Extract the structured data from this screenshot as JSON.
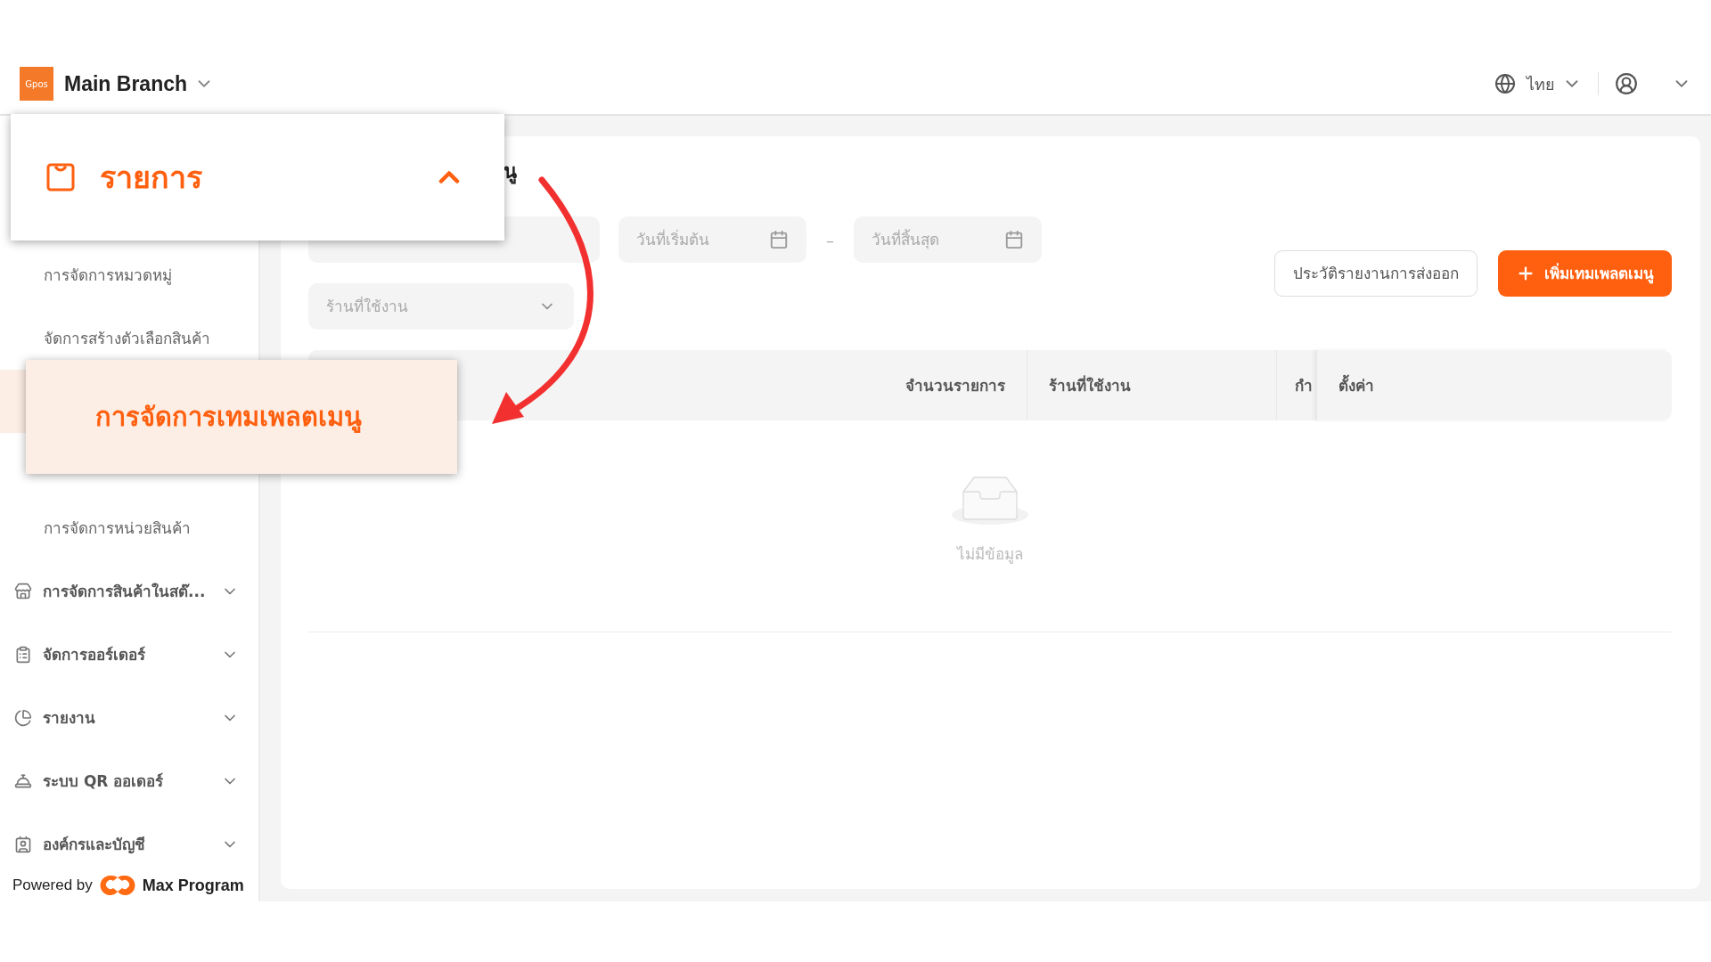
{
  "header": {
    "logo": "Gpos",
    "branch": "Main Branch",
    "language": "ไทย"
  },
  "sidebar": {
    "sub_items": [
      {
        "label": "การจัดการหมวดหมู่",
        "selected": false
      },
      {
        "label": "จัดการสร้างตัวเลือกสินค้า",
        "selected": false
      },
      {
        "selected": true
      },
      {
        "label": "การจัดการหน่วยสินค้า",
        "selected": false
      }
    ],
    "groups": [
      {
        "label": "การจัดการสินค้าในสต๊...",
        "expanded": false
      },
      {
        "label": "จัดการออร์เดอร์",
        "expanded": false
      },
      {
        "label": "รายงาน",
        "expanded": false
      },
      {
        "label": "ระบบ QR ออเดอร์",
        "expanded": false
      },
      {
        "label": "องค์กรและบัญชี",
        "expanded": false
      }
    ],
    "footer": {
      "prefix": "Powered by",
      "brand": "Max Program"
    }
  },
  "page": {
    "title": "นู",
    "start_date": {
      "placeholder": "วันที่เริ่มต้น"
    },
    "date_separator": "–",
    "end_date": {
      "placeholder": "วันที่สิ้นสุด"
    },
    "shop_select": {
      "placeholder": "ร้านที่ใช้งาน"
    },
    "buttons": [
      {
        "label": "ประวัติรายงานการส่งออก",
        "kind": "outline"
      },
      {
        "label": "เพิ่มเทมเพลตเมนู",
        "kind": "primary"
      }
    ],
    "table": {
      "columns": [
        {
          "label": "จำนวนรายการ"
        },
        {
          "label": "ร้านที่ใช้งาน"
        },
        {
          "label": "กำ"
        },
        {
          "label": "ตั้งค่า"
        }
      ],
      "empty_text": "ไม่มีข้อมูล"
    }
  },
  "callouts": [
    {
      "kind": "group",
      "label": "รายการ",
      "expanded": true
    },
    {
      "kind": "item",
      "label": "การจัดการเทมเพลตเมนู",
      "selected": true
    }
  ]
}
